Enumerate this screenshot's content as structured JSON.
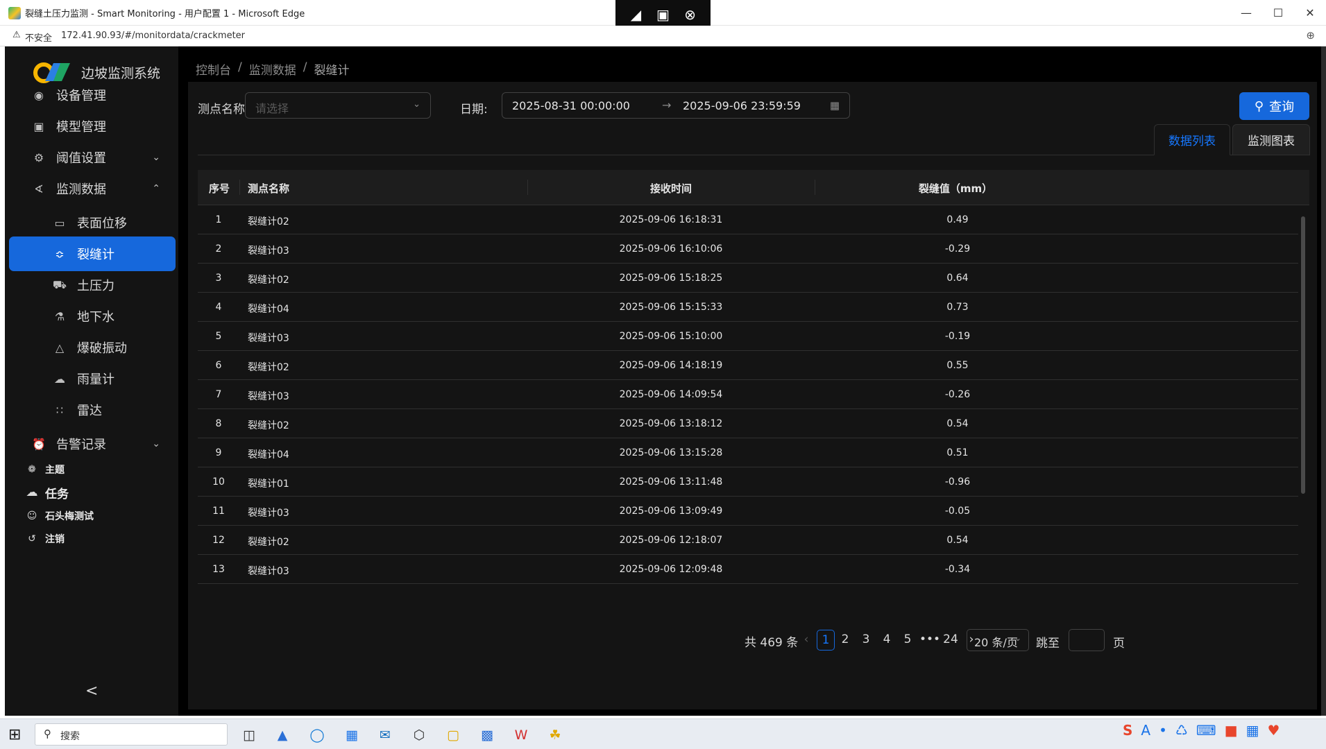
{
  "window": {
    "title": "裂缝土压力监测 - Smart Monitoring - 用户配置 1 - Microsoft Edge",
    "controls": [
      "minimize",
      "maximize",
      "close"
    ]
  },
  "remote_toolbar": {
    "icons": [
      "pin-icon",
      "fit-screen-icon",
      "disconnect-icon"
    ]
  },
  "address_bar": {
    "security_label": "不安全",
    "url": "172.41.90.93/#/monitordata/crackmeter"
  },
  "sidebar": {
    "logo_text": "边坡监测系统",
    "menu": [
      {
        "label": "设备管理",
        "icon": "location-pin-icon"
      },
      {
        "label": "模型管理",
        "icon": "monitor-icon"
      },
      {
        "label": "阈值设置",
        "icon": "gear-icon",
        "expandable": true
      },
      {
        "label": "监测数据",
        "icon": "line-chart-icon",
        "expanded": true
      },
      {
        "label": "表面位移",
        "icon": "desktop-icon"
      },
      {
        "label": "裂缝计",
        "icon": "chart-icon",
        "active": true
      },
      {
        "label": "土压力",
        "icon": "truck-icon"
      },
      {
        "label": "地下水",
        "icon": "flask-icon"
      },
      {
        "label": "爆破振动",
        "icon": "warning-icon"
      },
      {
        "label": "雨量计",
        "icon": "cloud-icon"
      },
      {
        "label": "雷达",
        "icon": "cluster-icon"
      },
      {
        "label": "告警记录",
        "icon": "alarm-icon",
        "expandable": true
      }
    ],
    "user_items": [
      {
        "label": "主题",
        "icon": "skin-icon"
      },
      {
        "label": "任务",
        "icon": "cloud-upload-icon"
      },
      {
        "label": "石头梅测试",
        "icon": "user-icon"
      },
      {
        "label": "注销",
        "icon": "logout-icon"
      }
    ],
    "collapse_glyph": "<"
  },
  "breadcrumb": [
    "控制台",
    "监测数据",
    "裂缝计"
  ],
  "filters": {
    "point_label": "测点名称:",
    "point_placeholder": "请选择",
    "date_label": "日期:",
    "date_start": "2025-08-31 00:00:00",
    "date_end": "2025-09-06 23:59:59",
    "query_label": "查询"
  },
  "tabs": [
    "数据列表",
    "监测图表"
  ],
  "table": {
    "columns": [
      "序号",
      "测点名称",
      "接收时间",
      "裂缝值（mm）"
    ],
    "rows": [
      [
        "1",
        "裂缝计02",
        "2025-09-06 16:18:31",
        "0.49"
      ],
      [
        "2",
        "裂缝计03",
        "2025-09-06 16:10:06",
        "-0.29"
      ],
      [
        "3",
        "裂缝计02",
        "2025-09-06 15:18:25",
        "0.64"
      ],
      [
        "4",
        "裂缝计04",
        "2025-09-06 15:15:33",
        "0.73"
      ],
      [
        "5",
        "裂缝计03",
        "2025-09-06 15:10:00",
        "-0.19"
      ],
      [
        "6",
        "裂缝计02",
        "2025-09-06 14:18:19",
        "0.55"
      ],
      [
        "7",
        "裂缝计03",
        "2025-09-06 14:09:54",
        "-0.26"
      ],
      [
        "8",
        "裂缝计02",
        "2025-09-06 13:18:12",
        "0.54"
      ],
      [
        "9",
        "裂缝计04",
        "2025-09-06 13:15:28",
        "0.51"
      ],
      [
        "10",
        "裂缝计01",
        "2025-09-06 13:11:48",
        "-0.96"
      ],
      [
        "11",
        "裂缝计03",
        "2025-09-06 13:09:49",
        "-0.05"
      ],
      [
        "12",
        "裂缝计02",
        "2025-09-06 12:18:07",
        "0.54"
      ],
      [
        "13",
        "裂缝计03",
        "2025-09-06 12:09:48",
        "-0.34"
      ]
    ]
  },
  "pagination": {
    "total": "共 469 条",
    "pages": [
      "1",
      "2",
      "3",
      "4",
      "5"
    ],
    "ellipsis": "•••",
    "last_page": "24",
    "current_page": "1",
    "page_size": "20 条/页",
    "jump_label": "跳至",
    "page_suffix": "页"
  },
  "taskbar": {
    "search_placeholder": "搜索"
  },
  "colors": {
    "accent": "#1668dc",
    "sidebar_bg": "#141414",
    "panel_bg": "#141414"
  }
}
